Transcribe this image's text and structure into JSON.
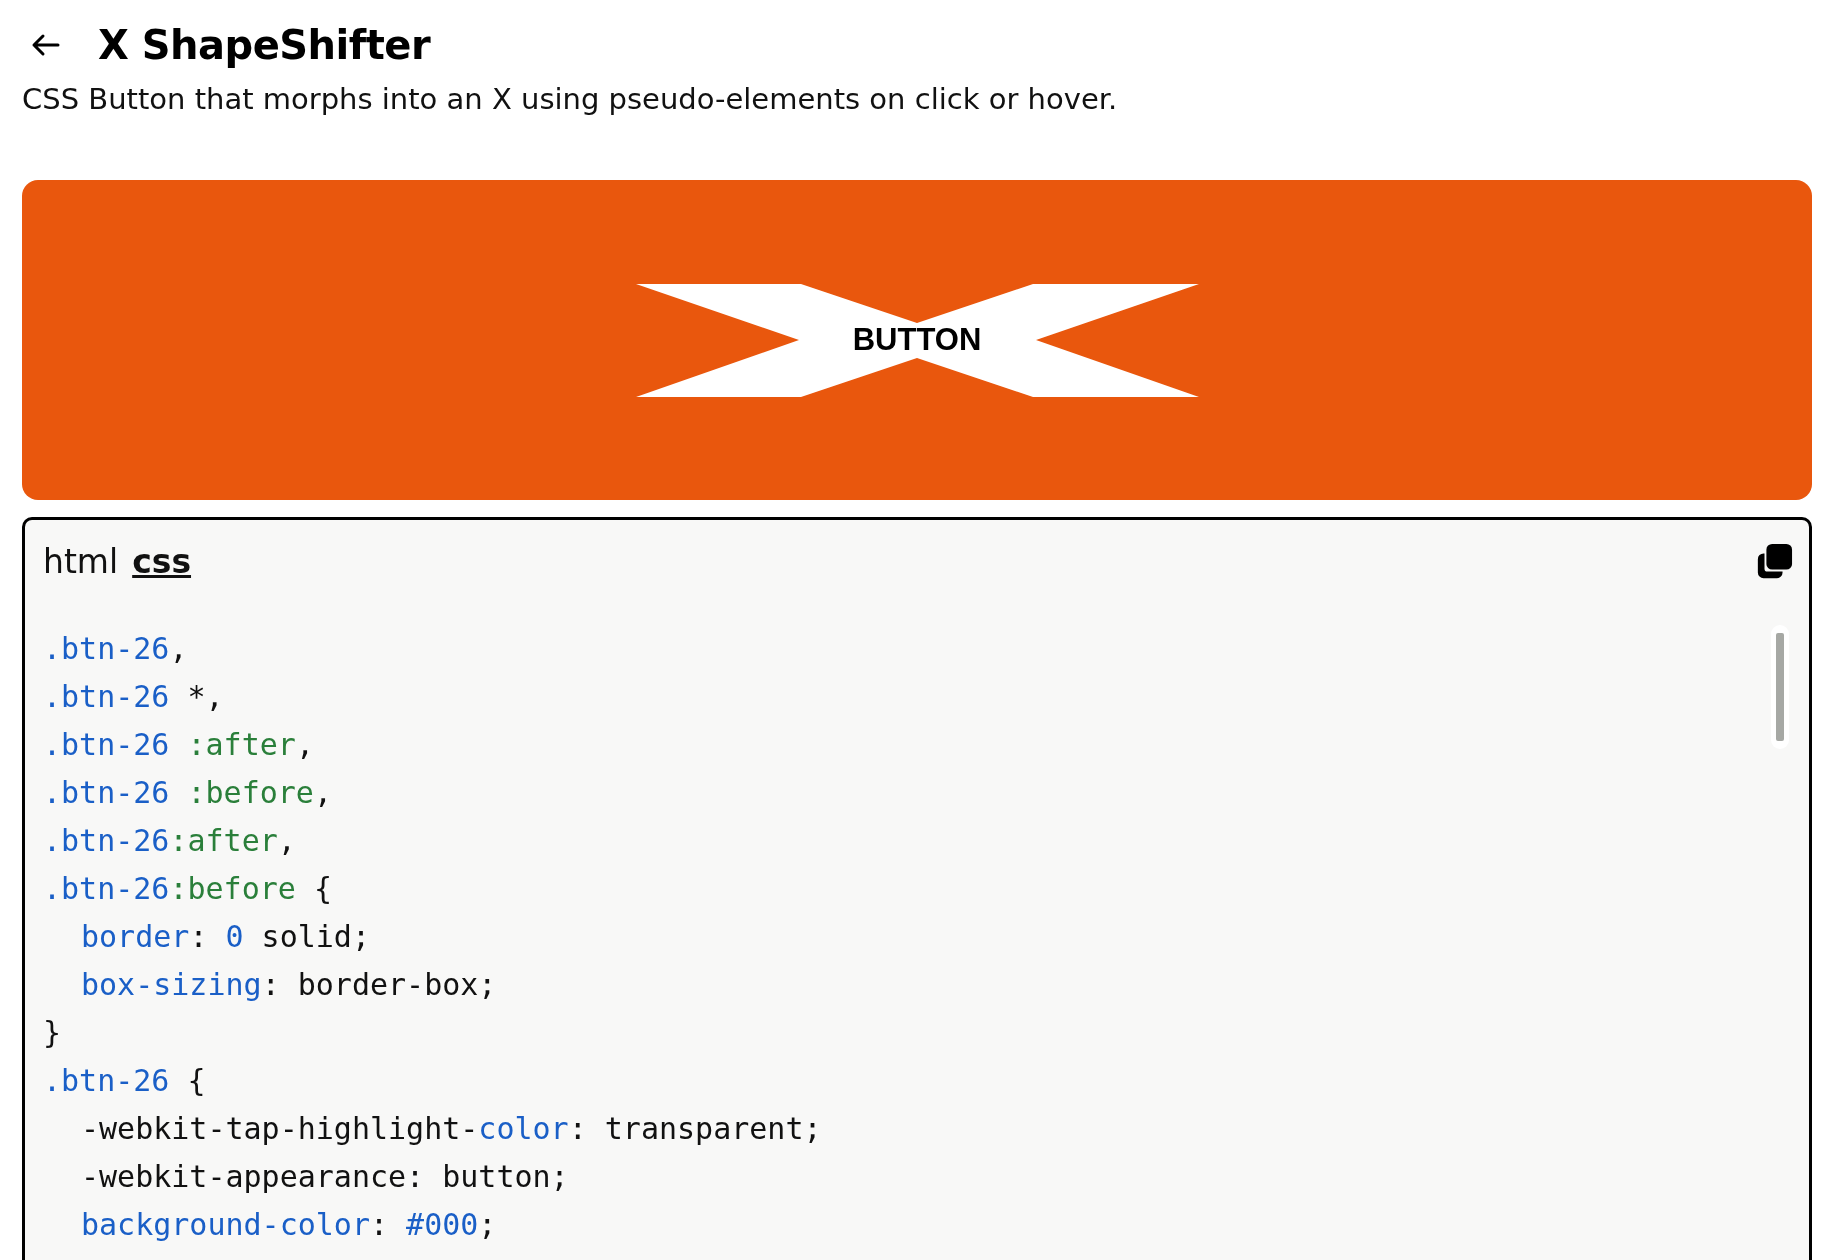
{
  "header": {
    "title": "X ShapeShifter",
    "description": "CSS Button that morphs into an X using pseudo-elements on click or hover."
  },
  "preview": {
    "button_label": "BUTTON"
  },
  "code_panel": {
    "tabs": [
      {
        "label": "html",
        "selected": false
      },
      {
        "label": "css",
        "selected": true
      }
    ],
    "lines": [
      {
        "indent": false,
        "tokens": [
          {
            "kind": "selector",
            "text": ".btn-26"
          },
          {
            "kind": "plain",
            "text": ","
          }
        ]
      },
      {
        "indent": false,
        "tokens": [
          {
            "kind": "selector",
            "text": ".btn-26"
          },
          {
            "kind": "plain",
            "text": " *,"
          }
        ]
      },
      {
        "indent": false,
        "tokens": [
          {
            "kind": "selector",
            "text": ".btn-26 "
          },
          {
            "kind": "pseudo",
            "text": ":after"
          },
          {
            "kind": "plain",
            "text": ","
          }
        ]
      },
      {
        "indent": false,
        "tokens": [
          {
            "kind": "selector",
            "text": ".btn-26 "
          },
          {
            "kind": "pseudo",
            "text": ":before"
          },
          {
            "kind": "plain",
            "text": ","
          }
        ]
      },
      {
        "indent": false,
        "tokens": [
          {
            "kind": "selector",
            "text": ".btn-26"
          },
          {
            "kind": "pseudo",
            "text": ":after"
          },
          {
            "kind": "plain",
            "text": ","
          }
        ]
      },
      {
        "indent": false,
        "tokens": [
          {
            "kind": "selector",
            "text": ".btn-26"
          },
          {
            "kind": "pseudo",
            "text": ":before"
          },
          {
            "kind": "plain",
            "text": " {"
          }
        ]
      },
      {
        "indent": true,
        "tokens": [
          {
            "kind": "property",
            "text": "border"
          },
          {
            "kind": "plain",
            "text": ": "
          },
          {
            "kind": "number",
            "text": "0"
          },
          {
            "kind": "plain",
            "text": " solid;"
          }
        ]
      },
      {
        "indent": true,
        "tokens": [
          {
            "kind": "property",
            "text": "box-sizing"
          },
          {
            "kind": "plain",
            "text": ": border-box;"
          }
        ]
      },
      {
        "indent": false,
        "tokens": [
          {
            "kind": "plain",
            "text": "}"
          }
        ]
      },
      {
        "indent": false,
        "tokens": [
          {
            "kind": "selector",
            "text": ".btn-26"
          },
          {
            "kind": "plain",
            "text": " {"
          }
        ]
      },
      {
        "indent": true,
        "tokens": [
          {
            "kind": "plain",
            "text": "-webkit-tap-highlight-"
          },
          {
            "kind": "property",
            "text": "color"
          },
          {
            "kind": "plain",
            "text": ": transparent;"
          }
        ]
      },
      {
        "indent": true,
        "tokens": [
          {
            "kind": "plain",
            "text": "-webkit-appearance: button;"
          }
        ]
      },
      {
        "indent": true,
        "tokens": [
          {
            "kind": "property",
            "text": "background-color"
          },
          {
            "kind": "plain",
            "text": ": "
          },
          {
            "kind": "number",
            "text": "#000"
          },
          {
            "kind": "plain",
            "text": ";"
          }
        ]
      }
    ]
  }
}
